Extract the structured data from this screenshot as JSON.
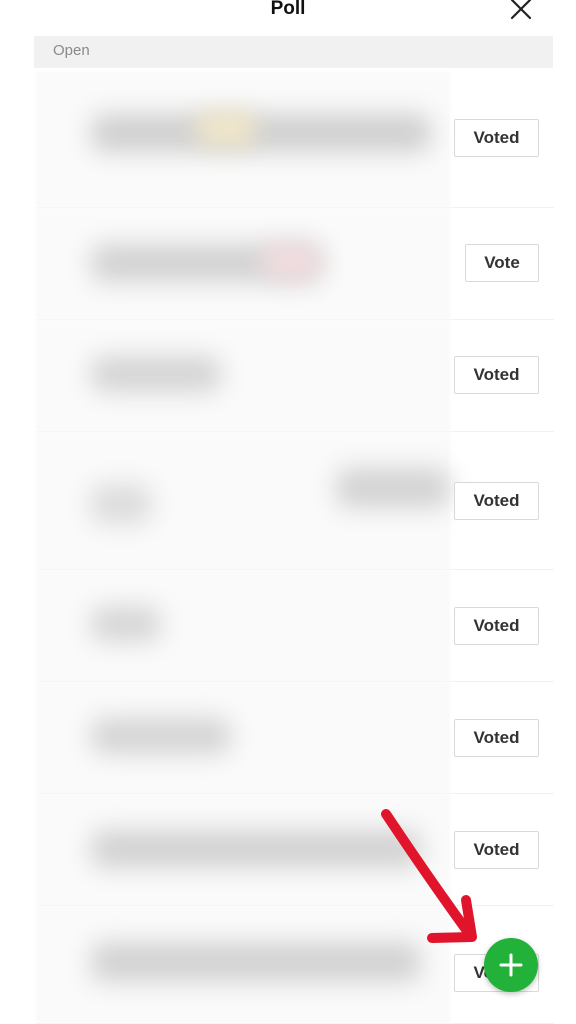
{
  "header": {
    "title": "Poll",
    "close_icon": "close-icon"
  },
  "section": {
    "label": "Open"
  },
  "polls": [
    {
      "button_label": "Voted",
      "state": "voted"
    },
    {
      "button_label": "Vote",
      "state": "vote"
    },
    {
      "button_label": "Voted",
      "state": "voted"
    },
    {
      "button_label": "Voted",
      "state": "voted"
    },
    {
      "button_label": "Voted",
      "state": "voted"
    },
    {
      "button_label": "Voted",
      "state": "voted"
    },
    {
      "button_label": "Voted",
      "state": "voted"
    },
    {
      "button_label": "Voted",
      "state": "voted"
    }
  ],
  "fab": {
    "icon": "plus-icon",
    "color": "#22b23a"
  },
  "annotation": {
    "icon": "red-arrow-icon",
    "color": "#e0142a"
  }
}
